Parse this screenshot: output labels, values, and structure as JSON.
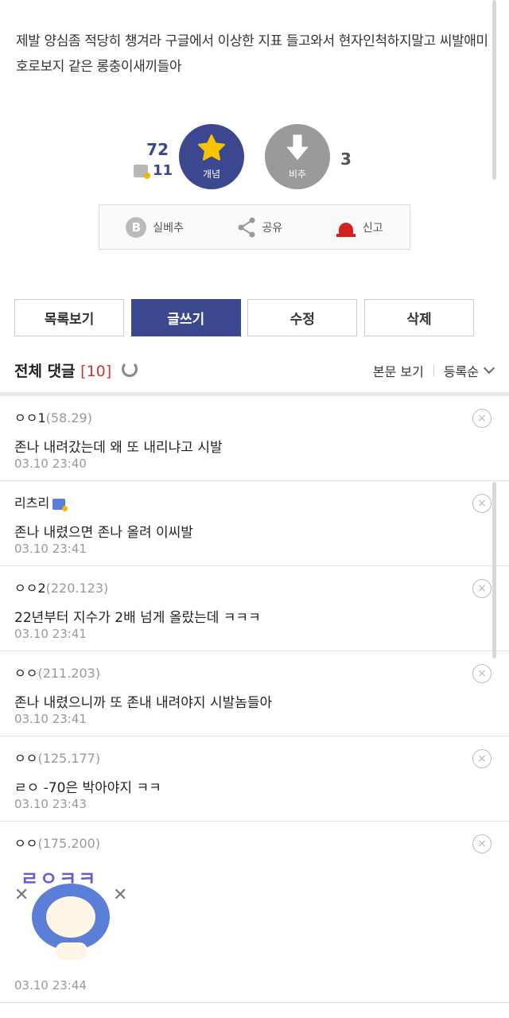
{
  "post": {
    "body": "제발 양심좀 적당히 챙겨라 구글에서 이상한 지표 들고와서 현자인척하지말고 씨발애미호로보지 같은 롱충이새끼들아"
  },
  "vote": {
    "up_count": "72",
    "fix_count": "11",
    "up_label": "개념",
    "down_label": "비추",
    "down_count": "3"
  },
  "actions": {
    "real_downvote": "실베추",
    "share": "공유",
    "report": "신고",
    "b_letter": "B"
  },
  "buttons": {
    "list": "목록보기",
    "write": "글쓰기",
    "edit": "수정",
    "delete": "삭제"
  },
  "comment_header": {
    "title": "전체 댓글",
    "count": "[10]",
    "view_post": "본문 보기",
    "sort": "등록순"
  },
  "comments": [
    {
      "nick": "ㅇㅇ1",
      "ip": "(58.29)",
      "content": "존나 내려갔는데 왜 또 내리냐고 시발",
      "date": "03.10 23:40"
    },
    {
      "nick": "리츠리",
      "ip": "",
      "content": "존나 내렸으면 존나 올려 이씨발",
      "date": "03.10 23:41"
    },
    {
      "nick": "ㅇㅇ2",
      "ip": "(220.123)",
      "content": "22년부터 지수가 2배 넘게 올랐는데 ㅋㅋㅋ",
      "date": "03.10 23:41"
    },
    {
      "nick": "ㅇㅇ",
      "ip": "(211.203)",
      "content": "존나 내렸으니까 또 존내 내려야지 시발놈들아",
      "date": "03.10 23:41"
    },
    {
      "nick": "ㅇㅇ",
      "ip": "(125.177)",
      "content": "ㄹㅇ -70은 박아야지 ㅋㅋ",
      "date": "03.10 23:43"
    },
    {
      "nick": "ㅇㅇ",
      "ip": "(175.200)",
      "content": "",
      "dccon_text": "ㄹㅇㅋㅋ",
      "date": "03.10 23:44"
    }
  ],
  "icons": {
    "delete": "×",
    "cross": "✕"
  },
  "colors": {
    "accent": "#3b4890",
    "downvote": "#9a9a9a",
    "report": "#d32020",
    "count_red": "#c13838"
  }
}
